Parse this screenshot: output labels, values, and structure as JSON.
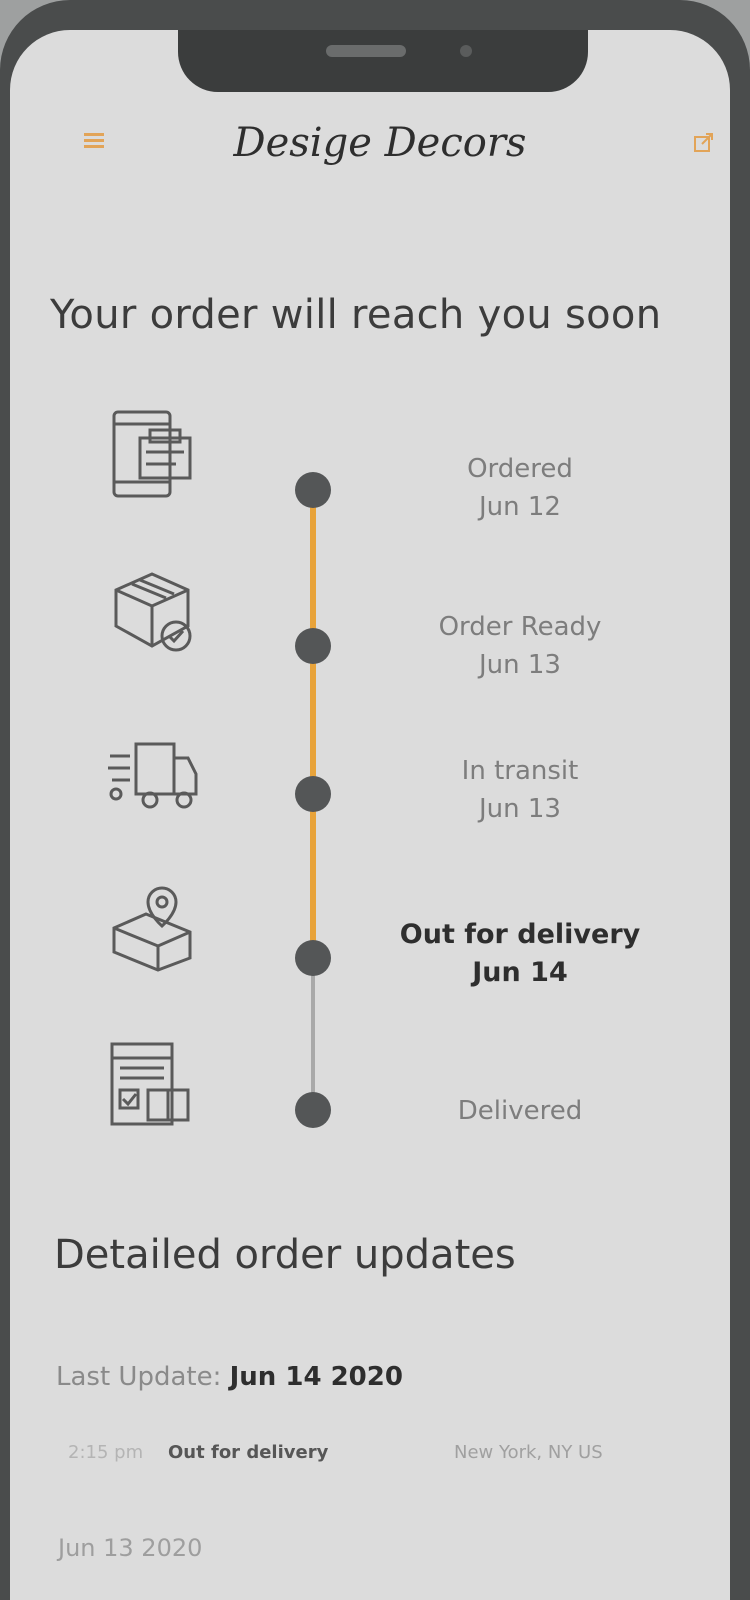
{
  "header": {
    "brand": "Desige Decors",
    "menu_icon": "hamburger-menu-icon",
    "share_icon": "share-icon",
    "accent_color": "#e8a33a"
  },
  "page_title": "Your order will reach you soon",
  "timeline": {
    "progress_color": "#e8a33a",
    "pending_color": "#a9a9a9",
    "steps": [
      {
        "icon": "ordered-icon",
        "label": "Ordered",
        "date": "Jun 12",
        "state": "done"
      },
      {
        "icon": "order-ready-box-icon",
        "label": "Order Ready",
        "date": "Jun 13",
        "state": "done"
      },
      {
        "icon": "in-transit-truck-icon",
        "label": "In transit",
        "date": "Jun 13",
        "state": "done"
      },
      {
        "icon": "out-for-delivery-icon",
        "label": "Out for delivery",
        "date": "Jun 14",
        "state": "current"
      },
      {
        "icon": "delivered-icon",
        "label": "Delivered",
        "date": "",
        "state": "pending"
      }
    ]
  },
  "detailed_updates": {
    "title": "Detailed order updates",
    "last_update_label": "Last Update:",
    "last_update_value": "Jun 14 2020",
    "entries": [
      {
        "time": "2:15 pm",
        "status": "Out for delivery",
        "location": "New York, NY US"
      }
    ],
    "previous_date": "Jun 13 2020"
  }
}
